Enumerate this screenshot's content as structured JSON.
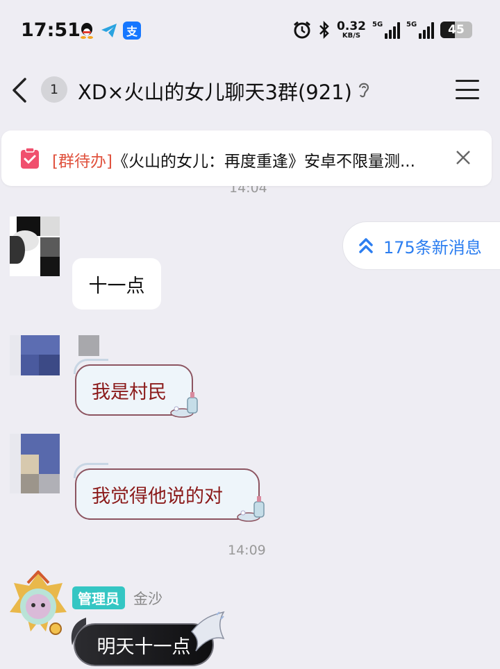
{
  "status_bar": {
    "time": "17:51",
    "net_speed_value": "0.32",
    "net_speed_unit": "KB/S",
    "signal1_label": "5G",
    "signal2_label": "5G",
    "battery_level": "45"
  },
  "header": {
    "unread_count": "1",
    "title": "XD×火山的女儿聊天3群(921)"
  },
  "todo_banner": {
    "tag": "[群待办]",
    "text": "《火山的女儿：再度重逢》安卓不限量测..."
  },
  "timestamps": [
    "14:04",
    "14:09"
  ],
  "new_messages": {
    "label": "175条新消息"
  },
  "messages": [
    {
      "text": "十一点"
    },
    {
      "text": "我是村民"
    },
    {
      "text": "我觉得他说的对"
    },
    {
      "role": "管理员",
      "sender": "金沙",
      "text": "明天十一点"
    }
  ],
  "colors": {
    "background": "#EEEDF3",
    "accent_blue": "#2C7EF0",
    "todo_tag": "#E0533F",
    "admin_tag": "#34C6C3",
    "deco_text": "#8B1A1A"
  }
}
